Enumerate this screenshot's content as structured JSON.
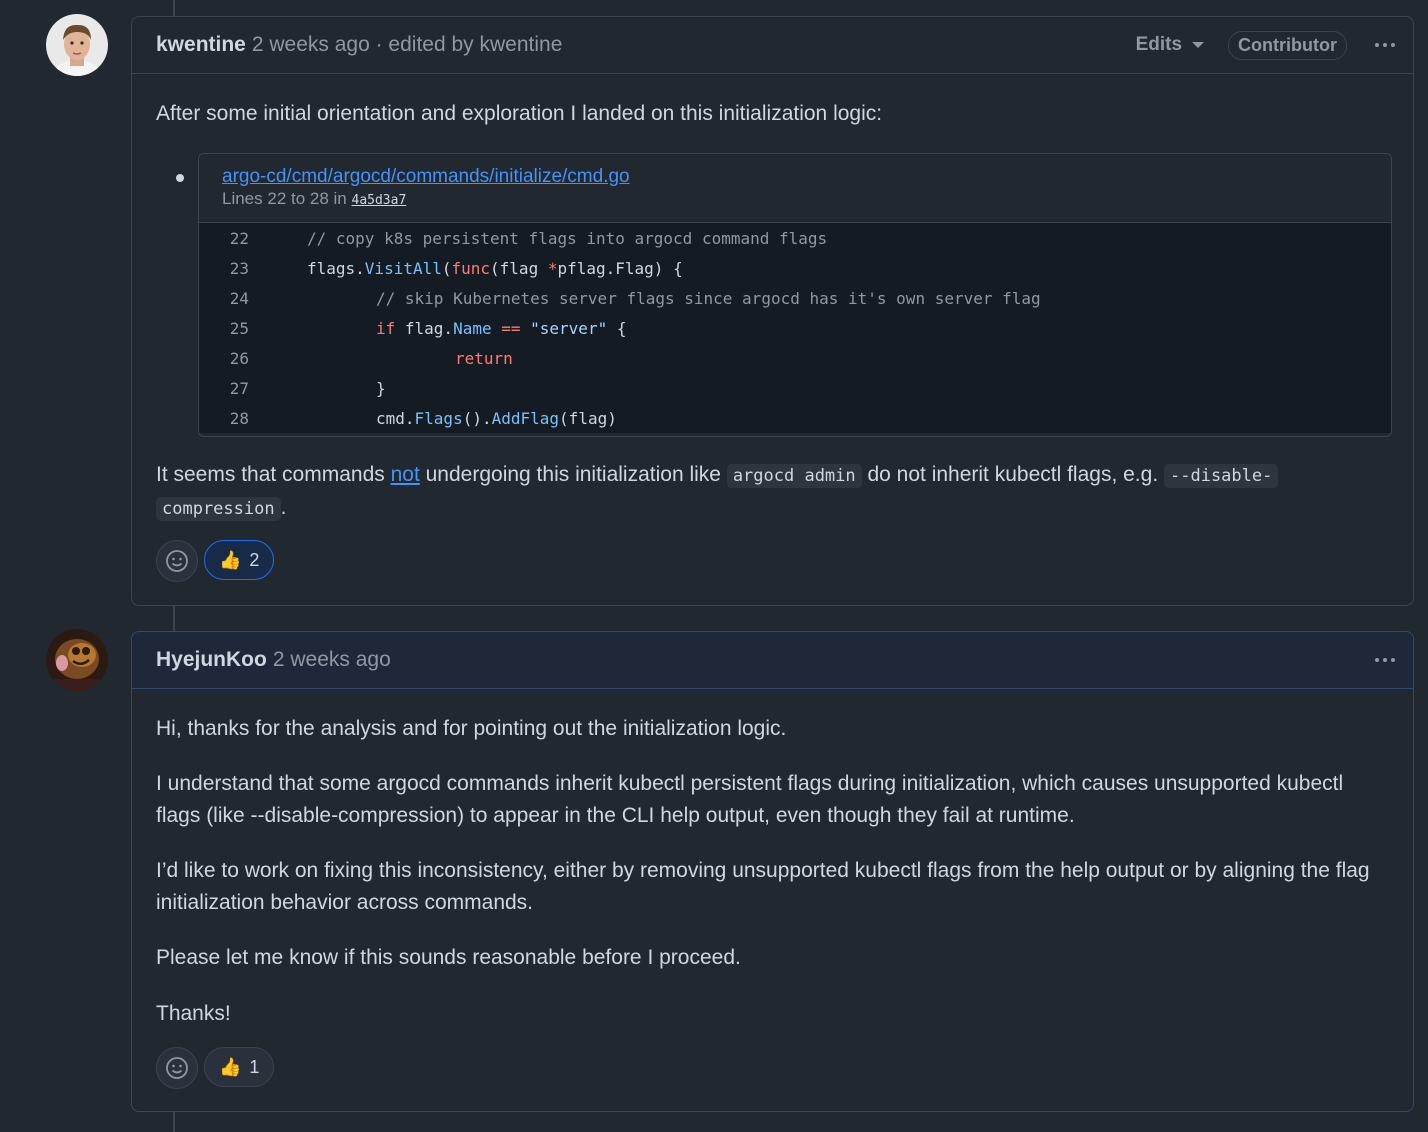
{
  "comments": [
    {
      "author": "kwentine",
      "meta": "2 weeks ago · edited by kwentine",
      "edits_label": "Edits",
      "badge": "Contributor",
      "intro": "After some initial orientation and exploration I landed on this initialization logic:",
      "snippet": {
        "path": "argo-cd/cmd/argocd/commands/initialize/cmd.go",
        "lines_prefix": "Lines 22 to 28 in",
        "sha": "4a5d3a7",
        "line_numbers": [
          "22",
          "23",
          "24",
          "25",
          "26",
          "27",
          "28"
        ]
      },
      "para2": {
        "t1": "It seems that commands ",
        "link": "not",
        "t2": " undergoing this initialization like ",
        "code1": "argocd admin",
        "t3": " do not inherit kubectl flags, e.g. ",
        "code2a": "--disable-",
        "code2b": "compression",
        "t4": "."
      },
      "reaction_emoji": "👍",
      "reaction_count": "2"
    },
    {
      "author": "HyejunKoo",
      "meta": "2 weeks ago",
      "paragraphs": [
        "Hi, thanks for the analysis and for pointing out the initialization logic.",
        "I understand that some argocd commands inherit kubectl persistent flags during initialization, which causes unsupported kubectl flags (like --disable-compression) to appear in the CLI help output, even though they fail at runtime.",
        "I’d like to work on fixing this inconsistency, either by removing unsupported kubectl flags from the help output or by aligning the flag initialization behavior across commands.",
        "Please let me know if this sounds reasonable before I proceed.",
        "Thanks!"
      ],
      "reaction_emoji": "👍",
      "reaction_count": "1"
    }
  ],
  "code_lines": [
    "// copy k8s persistent flags into argocd command flags",
    "flags.VisitAll(func(flag *pflag.Flag) {",
    "// skip Kubernetes server flags since argocd has it's own server flag",
    "if flag.Name == \"server\" {",
    "return",
    "}",
    "cmd.Flags().AddFlag(flag)"
  ]
}
